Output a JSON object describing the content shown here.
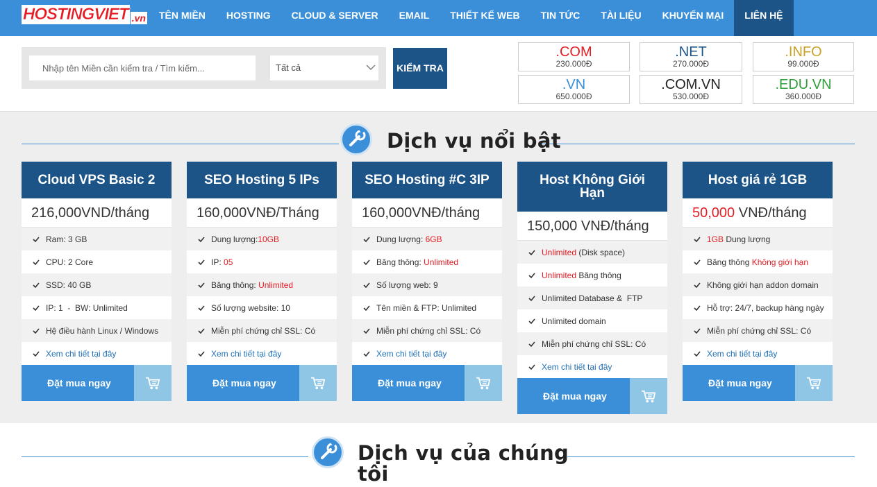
{
  "nav": {
    "logo_main": "HOSTINGVIET",
    "logo_tld": ".vn",
    "items": [
      "TÊN MIỀN",
      "HOSTING",
      "CLOUD & SERVER",
      "EMAIL",
      "THIẾT KẾ WEB",
      "TIN TỨC",
      "TÀI LIỆU",
      "KHUYẾN MẠI",
      "LIÊN HỆ"
    ]
  },
  "search": {
    "placeholder": "Nhập tên Miền cần kiểm tra / Tìm kiếm...",
    "select_value": "Tất cả",
    "button": "KIỂM TRA"
  },
  "domains": [
    {
      "name": ".COM",
      "price": "230.000Đ",
      "color": "#e51c23"
    },
    {
      "name": ".NET",
      "price": "270.000Đ",
      "color": "#1d5487"
    },
    {
      "name": ".INFO",
      "price": "99.000Đ",
      "color": "#c9a227"
    },
    {
      "name": ".VN",
      "price": "650.000Đ",
      "color": "#3a8fd8"
    },
    {
      "name": ".COM.VN",
      "price": "530.000Đ",
      "color": "#222222"
    },
    {
      "name": ".EDU.VN",
      "price": "360.000Đ",
      "color": "#2e9e3a"
    }
  ],
  "featured": {
    "title": "Dịch vụ nổi bật",
    "cards": [
      {
        "title": "Cloud VPS Basic 2",
        "price": "216,000VND/tháng",
        "features": [
          "Ram: 3 GB",
          "CPU: 2 Core",
          "SSD: 40 GB",
          "IP: 1  -  BW: Unlimited",
          "Hệ điều hành Linux / Windows"
        ],
        "link": "Xem chi tiết tại đây",
        "buy": "Đặt mua ngay"
      },
      {
        "title": "SEO Hosting 5 IPs",
        "price": "160,000VNĐ/Tháng",
        "features": [
          [
            "Dung lượng: ",
            "10GB"
          ],
          [
            "IP: ",
            "05"
          ],
          [
            "Băng thông: ",
            "Unlimited"
          ],
          "Số lượng website: 10",
          "Miễn phí chứng chỉ SSL: Có"
        ],
        "link": "Xem chi tiết tại đây",
        "buy": "Đặt mua ngay"
      },
      {
        "title": "SEO Hosting #C 3IP",
        "price": "160,000VNĐ/tháng",
        "features": [
          [
            "Dung lượng: ",
            "6GB"
          ],
          [
            "Băng thông: ",
            "Unlimited"
          ],
          "Số lượng web: 9",
          "Tên miền & FTP: Unlimited",
          "Miễn phí chứng chỉ SSL: Có"
        ],
        "link": "Xem chi tiết tại đây",
        "buy": "Đặt mua ngay"
      },
      {
        "title": "Host Không Giới Hạn",
        "price": "150,000 VNĐ/tháng",
        "features": [
          [
            "",
            "Unlimited",
            " (Disk space)"
          ],
          [
            "",
            "Unlimited",
            " Băng thông"
          ],
          "Unlimited Database &  FTP",
          "Unlimited domain",
          "Miễn phí chứng chỉ SSL: Có"
        ],
        "link": "Xem chi tiết tại đây",
        "buy": "Đặt mua ngay"
      },
      {
        "title": "Host giá rẻ 1GB",
        "price_red": "50,000",
        "price": " VNĐ/tháng",
        "features": [
          [
            "",
            "1GB",
            " Dung lượng"
          ],
          [
            "Băng thông ",
            "Không giới hạn"
          ],
          "Không giới hạn addon domain",
          "Hỗ trợ: 24/7, backup hàng ngày",
          "Miễn phí chứng chỉ SSL: Có"
        ],
        "link": "Xem chi tiết tại đây",
        "buy": "Đặt mua ngay"
      }
    ]
  },
  "services": {
    "title_line1": "Dịch vụ của chúng",
    "title_line2": "tôi"
  },
  "colors": {
    "nav": "#3a8fd8",
    "nav_active": "#1d5487",
    "card_head": "#1d5487",
    "buy": "#3a8fd8",
    "cart": "#8fc6e6",
    "red": "#e51c23"
  }
}
